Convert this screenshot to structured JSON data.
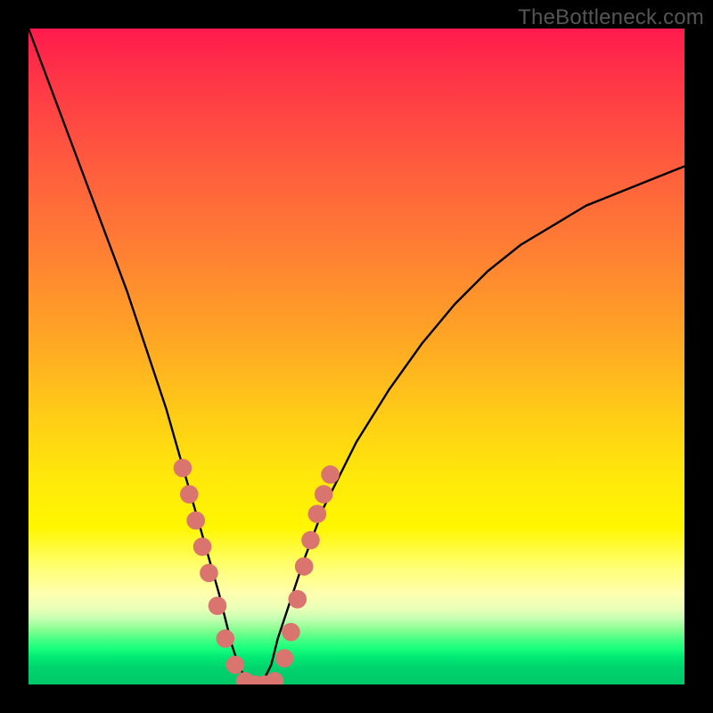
{
  "watermark": "TheBottleneck.com",
  "chart_data": {
    "type": "line",
    "title": "",
    "xlabel": "",
    "ylabel": "",
    "xlim": [
      0,
      100
    ],
    "ylim": [
      0,
      100
    ],
    "grid": false,
    "legend": false,
    "background_gradient": {
      "direction": "vertical",
      "stops": [
        {
          "pos": 0.0,
          "color": "#ff1a4d"
        },
        {
          "pos": 0.3,
          "color": "#ff7a35"
        },
        {
          "pos": 0.6,
          "color": "#ffd200"
        },
        {
          "pos": 0.82,
          "color": "#ffff9a"
        },
        {
          "pos": 0.9,
          "color": "#b8ffa6"
        },
        {
          "pos": 1.0,
          "color": "#00c868"
        }
      ]
    },
    "series": [
      {
        "name": "bottleneck-v-curve",
        "color": "#000000",
        "x": [
          0,
          3,
          6,
          9,
          12,
          15,
          18,
          21,
          23,
          25,
          27,
          29,
          30,
          31,
          32,
          33,
          34,
          35,
          36,
          37,
          38,
          40,
          42,
          45,
          50,
          55,
          60,
          65,
          70,
          75,
          80,
          85,
          90,
          95,
          100
        ],
        "y": [
          100,
          92,
          84,
          76,
          68,
          60,
          51,
          42,
          35,
          28,
          21,
          14,
          10,
          6,
          3,
          1,
          0,
          0,
          1,
          3,
          7,
          13,
          19,
          27,
          37,
          45,
          52,
          58,
          63,
          67,
          70,
          73,
          75,
          77,
          79
        ]
      }
    ],
    "marker_series": [
      {
        "name": "left-branch-dots",
        "shape": "circle",
        "color": "#d9746f",
        "radius_pct": 1.4,
        "points": [
          {
            "x": 23.5,
            "y": 33
          },
          {
            "x": 24.5,
            "y": 29
          },
          {
            "x": 25.5,
            "y": 25
          },
          {
            "x": 26.5,
            "y": 21
          },
          {
            "x": 27.5,
            "y": 17
          },
          {
            "x": 28.8,
            "y": 12
          },
          {
            "x": 30.0,
            "y": 7
          },
          {
            "x": 31.5,
            "y": 3
          },
          {
            "x": 33.0,
            "y": 0.5
          }
        ]
      },
      {
        "name": "bottom-dots",
        "shape": "circle",
        "color": "#d9746f",
        "radius_pct": 1.4,
        "points": [
          {
            "x": 34.5,
            "y": 0
          },
          {
            "x": 36.0,
            "y": 0
          },
          {
            "x": 37.5,
            "y": 0.5
          }
        ]
      },
      {
        "name": "right-branch-dots",
        "shape": "circle",
        "color": "#d9746f",
        "radius_pct": 1.4,
        "points": [
          {
            "x": 39.0,
            "y": 4
          },
          {
            "x": 40.0,
            "y": 8
          },
          {
            "x": 41.0,
            "y": 13
          },
          {
            "x": 42.0,
            "y": 18
          },
          {
            "x": 43.0,
            "y": 22
          },
          {
            "x": 44.0,
            "y": 26
          },
          {
            "x": 45.0,
            "y": 29
          },
          {
            "x": 46.0,
            "y": 32
          }
        ]
      }
    ]
  }
}
